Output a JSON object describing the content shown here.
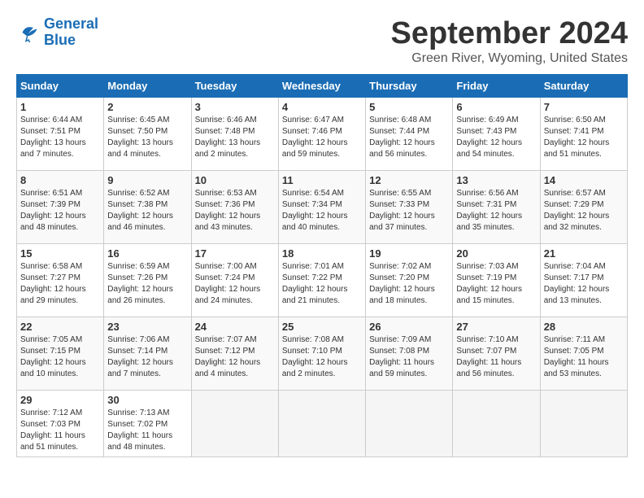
{
  "header": {
    "logo_line1": "General",
    "logo_line2": "Blue",
    "month_title": "September 2024",
    "location": "Green River, Wyoming, United States"
  },
  "weekdays": [
    "Sunday",
    "Monday",
    "Tuesday",
    "Wednesday",
    "Thursday",
    "Friday",
    "Saturday"
  ],
  "weeks": [
    [
      {
        "day": "1",
        "sunrise": "6:44 AM",
        "sunset": "7:51 PM",
        "daylight": "13 hours and 7 minutes."
      },
      {
        "day": "2",
        "sunrise": "6:45 AM",
        "sunset": "7:50 PM",
        "daylight": "13 hours and 4 minutes."
      },
      {
        "day": "3",
        "sunrise": "6:46 AM",
        "sunset": "7:48 PM",
        "daylight": "13 hours and 2 minutes."
      },
      {
        "day": "4",
        "sunrise": "6:47 AM",
        "sunset": "7:46 PM",
        "daylight": "12 hours and 59 minutes."
      },
      {
        "day": "5",
        "sunrise": "6:48 AM",
        "sunset": "7:44 PM",
        "daylight": "12 hours and 56 minutes."
      },
      {
        "day": "6",
        "sunrise": "6:49 AM",
        "sunset": "7:43 PM",
        "daylight": "12 hours and 54 minutes."
      },
      {
        "day": "7",
        "sunrise": "6:50 AM",
        "sunset": "7:41 PM",
        "daylight": "12 hours and 51 minutes."
      }
    ],
    [
      {
        "day": "8",
        "sunrise": "6:51 AM",
        "sunset": "7:39 PM",
        "daylight": "12 hours and 48 minutes."
      },
      {
        "day": "9",
        "sunrise": "6:52 AM",
        "sunset": "7:38 PM",
        "daylight": "12 hours and 46 minutes."
      },
      {
        "day": "10",
        "sunrise": "6:53 AM",
        "sunset": "7:36 PM",
        "daylight": "12 hours and 43 minutes."
      },
      {
        "day": "11",
        "sunrise": "6:54 AM",
        "sunset": "7:34 PM",
        "daylight": "12 hours and 40 minutes."
      },
      {
        "day": "12",
        "sunrise": "6:55 AM",
        "sunset": "7:33 PM",
        "daylight": "12 hours and 37 minutes."
      },
      {
        "day": "13",
        "sunrise": "6:56 AM",
        "sunset": "7:31 PM",
        "daylight": "12 hours and 35 minutes."
      },
      {
        "day": "14",
        "sunrise": "6:57 AM",
        "sunset": "7:29 PM",
        "daylight": "12 hours and 32 minutes."
      }
    ],
    [
      {
        "day": "15",
        "sunrise": "6:58 AM",
        "sunset": "7:27 PM",
        "daylight": "12 hours and 29 minutes."
      },
      {
        "day": "16",
        "sunrise": "6:59 AM",
        "sunset": "7:26 PM",
        "daylight": "12 hours and 26 minutes."
      },
      {
        "day": "17",
        "sunrise": "7:00 AM",
        "sunset": "7:24 PM",
        "daylight": "12 hours and 24 minutes."
      },
      {
        "day": "18",
        "sunrise": "7:01 AM",
        "sunset": "7:22 PM",
        "daylight": "12 hours and 21 minutes."
      },
      {
        "day": "19",
        "sunrise": "7:02 AM",
        "sunset": "7:20 PM",
        "daylight": "12 hours and 18 minutes."
      },
      {
        "day": "20",
        "sunrise": "7:03 AM",
        "sunset": "7:19 PM",
        "daylight": "12 hours and 15 minutes."
      },
      {
        "day": "21",
        "sunrise": "7:04 AM",
        "sunset": "7:17 PM",
        "daylight": "12 hours and 13 minutes."
      }
    ],
    [
      {
        "day": "22",
        "sunrise": "7:05 AM",
        "sunset": "7:15 PM",
        "daylight": "12 hours and 10 minutes."
      },
      {
        "day": "23",
        "sunrise": "7:06 AM",
        "sunset": "7:14 PM",
        "daylight": "12 hours and 7 minutes."
      },
      {
        "day": "24",
        "sunrise": "7:07 AM",
        "sunset": "7:12 PM",
        "daylight": "12 hours and 4 minutes."
      },
      {
        "day": "25",
        "sunrise": "7:08 AM",
        "sunset": "7:10 PM",
        "daylight": "12 hours and 2 minutes."
      },
      {
        "day": "26",
        "sunrise": "7:09 AM",
        "sunset": "7:08 PM",
        "daylight": "11 hours and 59 minutes."
      },
      {
        "day": "27",
        "sunrise": "7:10 AM",
        "sunset": "7:07 PM",
        "daylight": "11 hours and 56 minutes."
      },
      {
        "day": "28",
        "sunrise": "7:11 AM",
        "sunset": "7:05 PM",
        "daylight": "11 hours and 53 minutes."
      }
    ],
    [
      {
        "day": "29",
        "sunrise": "7:12 AM",
        "sunset": "7:03 PM",
        "daylight": "11 hours and 51 minutes."
      },
      {
        "day": "30",
        "sunrise": "7:13 AM",
        "sunset": "7:02 PM",
        "daylight": "11 hours and 48 minutes."
      },
      null,
      null,
      null,
      null,
      null
    ]
  ]
}
